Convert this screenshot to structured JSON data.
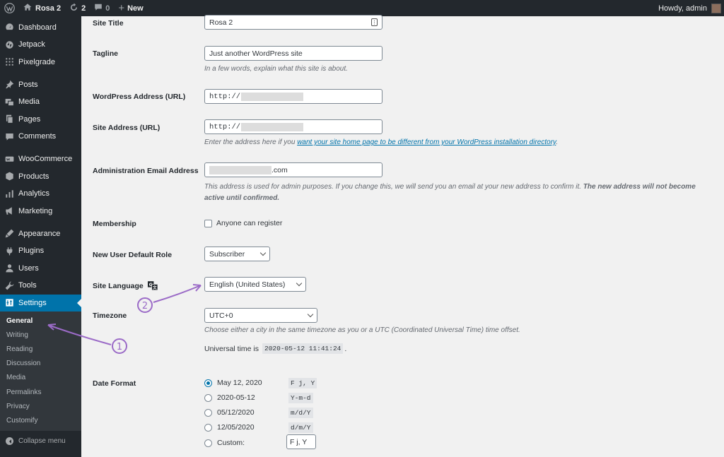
{
  "adminbar": {
    "site_name": "Rosa 2",
    "updates_count": "2",
    "comments_count": "0",
    "new_label": "New",
    "howdy": "Howdy, admin"
  },
  "sidebar": {
    "items": [
      {
        "label": "Dashboard",
        "icon": "dashboard-icon"
      },
      {
        "label": "Jetpack",
        "icon": "jetpack-icon"
      },
      {
        "label": "Pixelgrade",
        "icon": "pixelgrade-icon"
      },
      {
        "label": "Posts",
        "icon": "pin-icon"
      },
      {
        "label": "Media",
        "icon": "media-icon"
      },
      {
        "label": "Pages",
        "icon": "pages-icon"
      },
      {
        "label": "Comments",
        "icon": "comments-icon"
      },
      {
        "label": "WooCommerce",
        "icon": "woocommerce-icon"
      },
      {
        "label": "Products",
        "icon": "products-icon"
      },
      {
        "label": "Analytics",
        "icon": "analytics-icon"
      },
      {
        "label": "Marketing",
        "icon": "marketing-icon"
      },
      {
        "label": "Appearance",
        "icon": "appearance-icon"
      },
      {
        "label": "Plugins",
        "icon": "plugins-icon"
      },
      {
        "label": "Users",
        "icon": "users-icon"
      },
      {
        "label": "Tools",
        "icon": "tools-icon"
      },
      {
        "label": "Settings",
        "icon": "settings-icon"
      }
    ],
    "submenu": [
      "General",
      "Writing",
      "Reading",
      "Discussion",
      "Media",
      "Permalinks",
      "Privacy",
      "Customify"
    ],
    "collapse_label": "Collapse menu"
  },
  "form": {
    "site_title": {
      "label": "Site Title",
      "value": "Rosa 2"
    },
    "tagline": {
      "label": "Tagline",
      "value": "Just another WordPress site",
      "desc": "In a few words, explain what this site is about."
    },
    "wp_address": {
      "label": "WordPress Address (URL)",
      "value": "http://"
    },
    "site_address": {
      "label": "Site Address (URL)",
      "value": "http://",
      "desc_prefix": "Enter the address here if you ",
      "desc_link": "want your site home page to be different from your WordPress installation directory",
      "desc_suffix": "."
    },
    "admin_email": {
      "label": "Administration Email Address",
      "value_suffix": ".com",
      "desc": "This address is used for admin purposes. If you change this, we will send you an email at your new address to confirm it. ",
      "desc_bold": "The new address will not become active until confirmed."
    },
    "membership": {
      "label": "Membership",
      "checkbox_label": "Anyone can register"
    },
    "default_role": {
      "label": "New User Default Role",
      "value": "Subscriber"
    },
    "site_language": {
      "label": "Site Language",
      "value": "English (United States)"
    },
    "timezone": {
      "label": "Timezone",
      "value": "UTC+0",
      "desc": "Choose either a city in the same timezone as you or a UTC (Coordinated Universal Time) time offset.",
      "universal_prefix": "Universal time is",
      "universal_value": "2020-05-12 11:41:24",
      "universal_suffix": "."
    },
    "date_format": {
      "label": "Date Format",
      "options": [
        {
          "label": "May 12, 2020",
          "code": "F j, Y"
        },
        {
          "label": "2020-05-12",
          "code": "Y-m-d"
        },
        {
          "label": "05/12/2020",
          "code": "m/d/Y"
        },
        {
          "label": "12/05/2020",
          "code": "d/m/Y"
        }
      ],
      "custom_label": "Custom:",
      "custom_value": "F j, Y"
    }
  },
  "annotations": {
    "one": "1",
    "two": "2",
    "color": "#9b6bc7"
  },
  "colors": {
    "accent": "#0073aa",
    "sidebar": "#23282d"
  }
}
